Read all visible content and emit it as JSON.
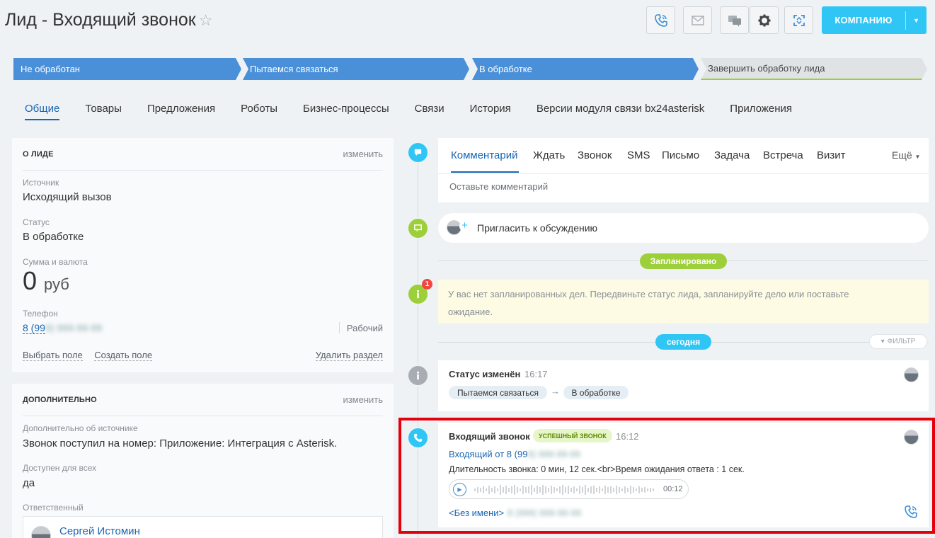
{
  "header": {
    "title": "Лид - Входящий звонок",
    "company_button": "КОМПАНИЮ"
  },
  "stages": [
    {
      "label": "Не обработан"
    },
    {
      "label": "Пытаемся связаться"
    },
    {
      "label": "В обработке"
    },
    {
      "label": "Завершить обработку лида"
    }
  ],
  "tabs": [
    "Общие",
    "Товары",
    "Предложения",
    "Роботы",
    "Бизнес-процессы",
    "Связи",
    "История",
    "Версии модуля связи bx24asterisk",
    "Приложения"
  ],
  "about": {
    "heading": "О ЛИДЕ",
    "edit": "изменить",
    "source_label": "Источник",
    "source_value": "Исходящий вызов",
    "status_label": "Статус",
    "status_value": "В обработке",
    "sum_label": "Сумма и валюта",
    "sum_value": "0",
    "currency": "руб",
    "phone_label": "Телефон",
    "phone_value": "8 (99",
    "phone_hidden": "9) 999-99-99",
    "phone_type": "Рабочий",
    "choose_field": "Выбрать поле",
    "create_field": "Создать поле",
    "delete_section": "Удалить раздел"
  },
  "extra": {
    "heading": "ДОПОЛНИТЕЛЬНО",
    "edit": "изменить",
    "source_info_label": "Дополнительно об источнике",
    "source_info_value": "Звонок поступил на номер: Приложение: Интеграция с Asterisk.",
    "public_label": "Доступен для всех",
    "public_value": "да",
    "responsible_label": "Ответственный",
    "responsible_name": "Сергей Истомин"
  },
  "timeline": {
    "tabs": [
      "Комментарий",
      "Ждать",
      "Звонок",
      "SMS",
      "Письмо",
      "Задача",
      "Встреча",
      "Визит"
    ],
    "more": "Ещё",
    "comment_placeholder": "Оставьте комментарий",
    "invite": "Пригласить к обсуждению",
    "planned_badge": "Запланировано",
    "no_tasks_badge": "1",
    "no_tasks": "У вас нет запланированных дел. Передвиньте статус лида, запланируйте дело или поставьте ожидание.",
    "today_badge": "сегодня",
    "filter": "ФИЛЬТР",
    "status_event": {
      "title": "Статус изменён",
      "time": "16:17",
      "from": "Пытаемся связаться",
      "to": "В обработке"
    },
    "call_event": {
      "title": "Входящий звонок",
      "badge": "УСПЕШНЫЙ ЗВОНОК",
      "time": "16:12",
      "from_link": "Входящий от 8 (99",
      "from_hidden": "9) 999-99-99",
      "duration": "Длительность звонка: 0 мин, 12 сек.<br>Время ожидания ответа : 1 сек.",
      "player_time": "00:12",
      "noname": "<Без имени>",
      "noname_hidden": "8 (999) 999-99-99"
    }
  },
  "colors": {
    "accent": "#2fc6f6",
    "stage_blue": "#4a90d9",
    "green": "#9dcf3a",
    "link": "#1a66b3",
    "highlight": "#e5000c"
  }
}
